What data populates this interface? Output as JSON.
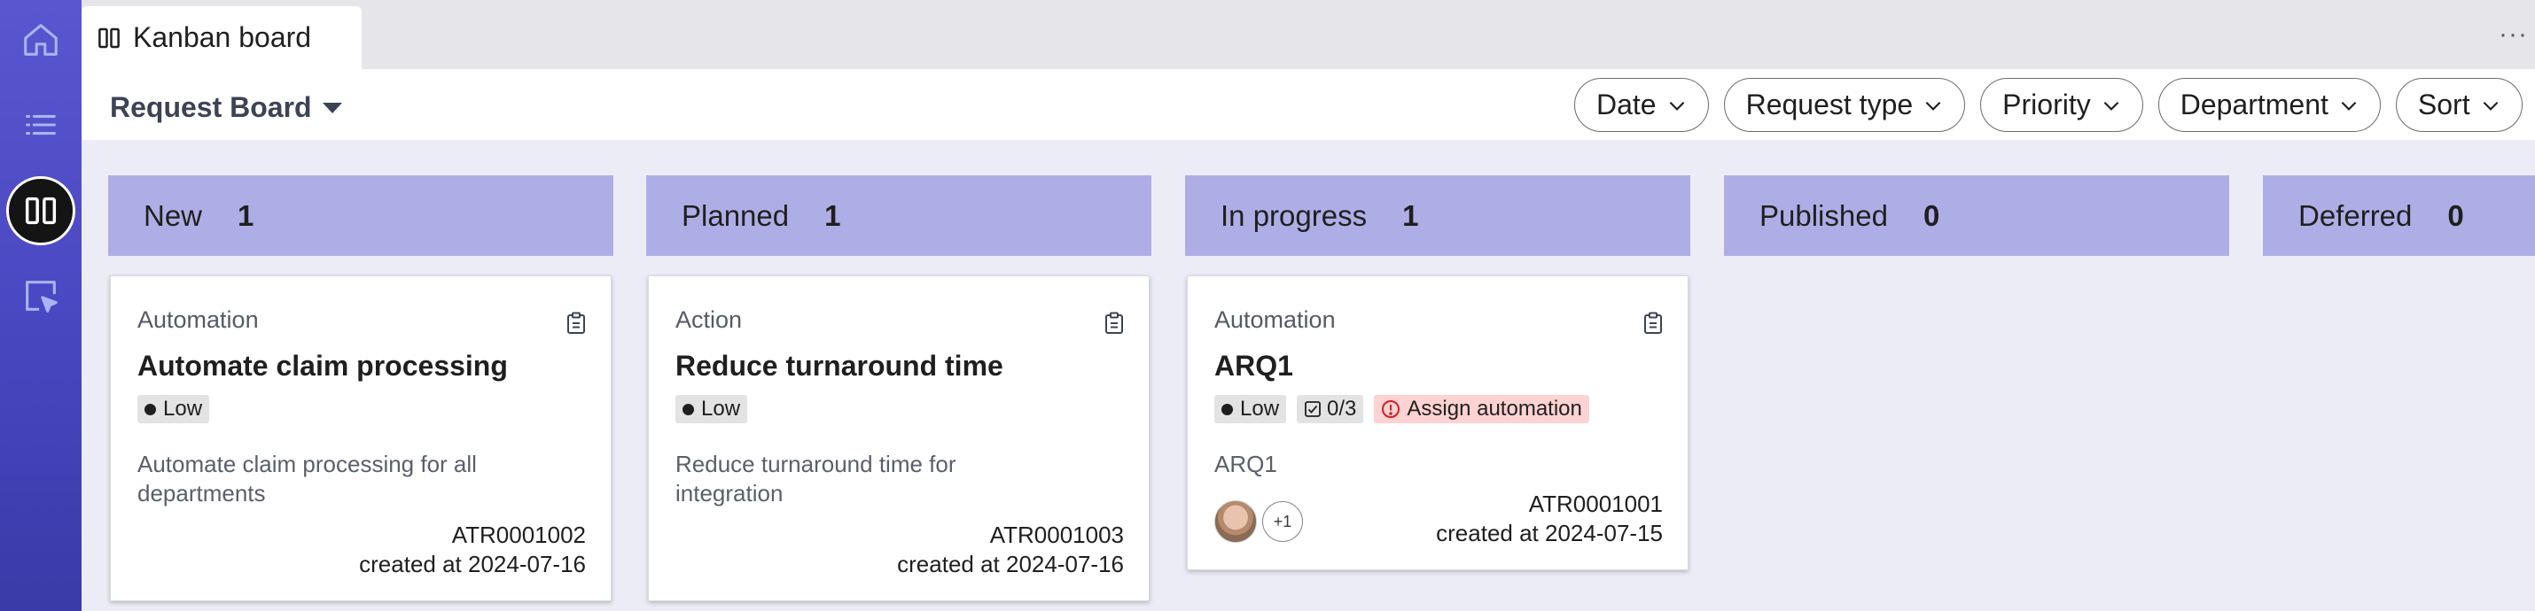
{
  "colors": {
    "sidebar": "#4a48c2",
    "column_header": "#aeaee6",
    "board_bg": "#ececf6",
    "warning_badge": "#fdd2d2",
    "priority_badge": "#e3e3e3"
  },
  "sidebar": {
    "items": [
      {
        "icon": "home-icon",
        "active": false
      },
      {
        "icon": "list-icon",
        "active": false
      },
      {
        "icon": "kanban-icon",
        "active": true
      },
      {
        "icon": "cursor-select-icon",
        "active": false
      }
    ]
  },
  "tab": {
    "icon": "kanban-icon",
    "label": "Kanban board"
  },
  "toolbar": {
    "board_title": "Request Board",
    "filters": [
      "Date",
      "Request type",
      "Priority",
      "Department",
      "Sort"
    ]
  },
  "columns": [
    {
      "title": "New",
      "count": "1",
      "cards": [
        {
          "type": "Automation",
          "title": "Automate claim processing",
          "priority": "Low",
          "description": "Automate claim processing for all departments",
          "id": "ATR0001002",
          "created": "created at 2024-07-16"
        }
      ]
    },
    {
      "title": "Planned",
      "count": "1",
      "cards": [
        {
          "type": "Action",
          "title": "Reduce turnaround time",
          "priority": "Low",
          "description": "Reduce turnaround time for integration",
          "id": "ATR0001003",
          "created": "created at 2024-07-16"
        }
      ]
    },
    {
      "title": "In progress",
      "count": "1",
      "cards": [
        {
          "type": "Automation",
          "title": "ARQ1",
          "priority": "Low",
          "tasks": "0/3",
          "warning": "Assign automation",
          "description": "ARQ1",
          "avatar_more": "+1",
          "id": "ATR0001001",
          "created": "created at 2024-07-15"
        }
      ]
    },
    {
      "title": "Published",
      "count": "0",
      "cards": []
    },
    {
      "title": "Deferred",
      "count": "0",
      "cards": []
    }
  ]
}
